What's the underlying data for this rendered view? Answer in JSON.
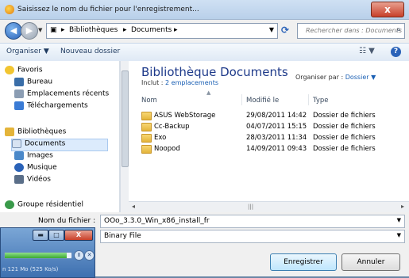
{
  "window": {
    "title": "Saisissez le nom du fichier pour l'enregistrement...",
    "close_label": "x"
  },
  "address": {
    "crumbs": [
      "Bibliothèques",
      "Documents"
    ],
    "search_placeholder": "Rechercher dans : Documents"
  },
  "toolbar": {
    "organize_label": "Organiser",
    "new_folder_label": "Nouveau dossier"
  },
  "nav": {
    "favorites": "Favoris",
    "desktop": "Bureau",
    "recent": "Emplacements récents",
    "downloads": "Téléchargements",
    "libraries": "Bibliothèques",
    "documents": "Documents",
    "images": "Images",
    "music": "Musique",
    "videos": "Vidéos",
    "homegroup": "Groupe résidentiel"
  },
  "library": {
    "title": "Bibliothèque Documents",
    "include_prefix": "Inclut :",
    "include_link": "2 emplacements",
    "arrange_label": "Organiser par :",
    "arrange_value": "Dossier"
  },
  "columns": {
    "name": "Nom",
    "modified": "Modifié le",
    "type": "Type"
  },
  "files": [
    {
      "name": "ASUS WebStorage",
      "modified": "29/08/2011 14:42",
      "type": "Dossier de fichiers"
    },
    {
      "name": "Cc-Backup",
      "modified": "04/07/2011 15:15",
      "type": "Dossier de fichiers"
    },
    {
      "name": "Exo",
      "modified": "28/03/2011 11:34",
      "type": "Dossier de fichiers"
    },
    {
      "name": "Noopod",
      "modified": "14/09/2011 09:43",
      "type": "Dossier de fichiers"
    }
  ],
  "form": {
    "filename_label": "Nom du fichier :",
    "filename_value": "OOo_3.3.0_Win_x86_install_fr",
    "type_value": "Binary File"
  },
  "buttons": {
    "save": "Enregistrer",
    "cancel": "Annuler"
  },
  "taskwin": {
    "status": "n 121 Mo (525 Ko/s)",
    "progress": 0.93
  }
}
